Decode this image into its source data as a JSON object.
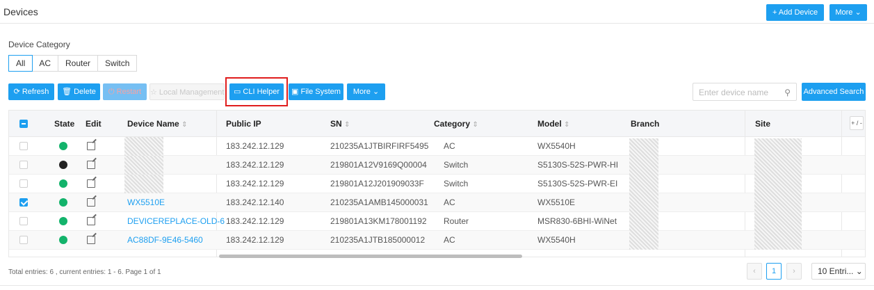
{
  "header": {
    "title": "Devices",
    "add_device": "+ Add Device",
    "more": "More ⌄"
  },
  "category": {
    "label": "Device Category",
    "options": [
      "All",
      "AC",
      "Router",
      "Switch"
    ],
    "selected": "All"
  },
  "toolbar": {
    "refresh": "⟳ Refresh",
    "delete": "🗑 Delete",
    "restart": "⏻ Restart",
    "local_management": "☆ Local Management",
    "cli_helper": "▭ CLI Helper",
    "file_system": "▣ File System",
    "more": "More ⌄"
  },
  "search": {
    "placeholder": "Enter device name",
    "advanced": "Advanced Search"
  },
  "table": {
    "columns": {
      "state": "State",
      "edit": "Edit",
      "device_name": "Device Name",
      "public_ip": "Public IP",
      "sn": "SN",
      "category": "Category",
      "model": "Model",
      "branch": "Branch",
      "site": "Site",
      "column_picker": "+ / -"
    },
    "sort_glyph": "⇕",
    "rows": [
      {
        "checked": false,
        "state": "online",
        "name": "",
        "ip": "183.242.12.129",
        "sn": "210235A1JTBIRFIRF5495",
        "category": "AC",
        "model": "WX5540H"
      },
      {
        "checked": false,
        "state": "offline",
        "name": "",
        "ip": "183.242.12.129",
        "sn": "219801A12V9169Q00004",
        "category": "Switch",
        "model": "S5130S-52S-PWR-HI"
      },
      {
        "checked": false,
        "state": "online",
        "name": "",
        "ip": "183.242.12.129",
        "sn": "219801A12J201909033F",
        "category": "Switch",
        "model": "S5130S-52S-PWR-EI"
      },
      {
        "checked": true,
        "state": "online",
        "name": "WX5510E",
        "ip": "183.242.12.140",
        "sn": "210235A1AMB145000031",
        "category": "AC",
        "model": "WX5510E"
      },
      {
        "checked": false,
        "state": "online",
        "name": "DEVICEREPLACE-OLD-6",
        "ip": "183.242.12.129",
        "sn": "219801A13KM178001192",
        "category": "Router",
        "model": "MSR830-6BHI-WiNet"
      },
      {
        "checked": false,
        "state": "online",
        "name": "AC88DF-9E46-5460",
        "ip": "183.242.12.129",
        "sn": "210235A1JTB185000012",
        "category": "AC",
        "model": "WX5540H"
      }
    ]
  },
  "footer": {
    "summary": "Total entries: 6 , current entries: 1 - 6. Page 1 of 1",
    "prev": "‹",
    "page": "1",
    "next": "›",
    "page_size": "10 Entri... ⌄"
  },
  "colors": {
    "accent": "#1d9ff0",
    "online": "#13b36b",
    "offline": "#222222",
    "highlight": "#e01d1d"
  }
}
